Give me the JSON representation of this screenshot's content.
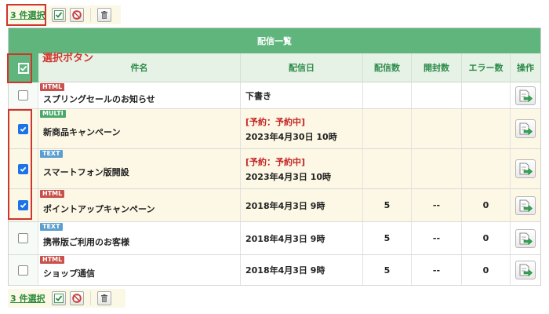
{
  "toolbar": {
    "selection_label": "3 件選択",
    "buttons": [
      "check-all",
      "uncheck-all",
      "delete"
    ]
  },
  "annotation": {
    "text": "選択ボタン"
  },
  "table": {
    "caption": "配信一覧",
    "columns": [
      "件名",
      "配信日",
      "配信数",
      "開封数",
      "エラー数",
      "操作"
    ],
    "rows": [
      {
        "checked": false,
        "type": "HTML",
        "subject": "スプリングセールのお知らせ",
        "reserve": "",
        "date": "下書き",
        "sent": "",
        "opened": "",
        "errors": ""
      },
      {
        "checked": true,
        "type": "MULTI",
        "subject": "新商品キャンペーン",
        "reserve": "[予約：予約中]",
        "date": "2023年4月30日 10時",
        "sent": "",
        "opened": "",
        "errors": ""
      },
      {
        "checked": true,
        "type": "TEXT",
        "subject": "スマートフォン版開設",
        "reserve": "[予約：予約中]",
        "date": "2023年4月3日 10時",
        "sent": "",
        "opened": "",
        "errors": ""
      },
      {
        "checked": true,
        "type": "HTML",
        "subject": "ポイントアップキャンペーン",
        "reserve": "",
        "date": "2018年4月3日 9時",
        "sent": "5",
        "opened": "--",
        "errors": "0"
      },
      {
        "checked": false,
        "type": "TEXT",
        "subject": "携帯版ご利用のお客様",
        "reserve": "",
        "date": "2018年4月3日 9時",
        "sent": "5",
        "opened": "--",
        "errors": "0"
      },
      {
        "checked": false,
        "type": "HTML",
        "subject": "ショップ通信",
        "reserve": "",
        "date": "2018年4月3日 9時",
        "sent": "5",
        "opened": "--",
        "errors": "0"
      }
    ]
  },
  "colors": {
    "header_green": "#5fb57c",
    "accent_red": "#d0342c",
    "reserve_red": "#c42424",
    "selected_row": "#fcf8e5"
  }
}
